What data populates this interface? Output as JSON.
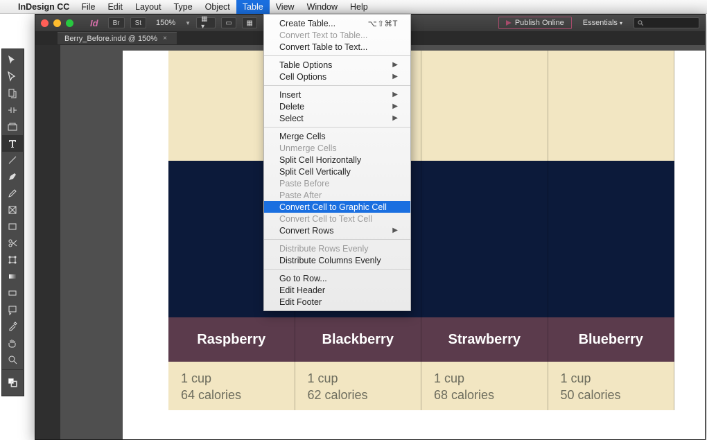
{
  "menubar": {
    "app_name": "InDesign CC",
    "items": [
      "File",
      "Edit",
      "Layout",
      "Type",
      "Object",
      "Table",
      "View",
      "Window",
      "Help"
    ],
    "active": "Table"
  },
  "window": {
    "zoom": "150%",
    "br_btn": "Br",
    "st_btn": "St",
    "publish": "Publish Online",
    "workspace": "Essentials"
  },
  "doc_tab": {
    "title": "Berry_Before.indd @ 150%"
  },
  "table": {
    "headers": [
      "Raspberry",
      "Blackberry",
      "Strawberry",
      "Blueberry"
    ],
    "cells": [
      {
        "amount": "1 cup",
        "calories": "64 calories"
      },
      {
        "amount": "1 cup",
        "calories": "62 calories"
      },
      {
        "amount": "1 cup",
        "calories": "68 calories"
      },
      {
        "amount": "1 cup",
        "calories": "50 calories"
      }
    ]
  },
  "dropdown": {
    "create_table": "Create Table...",
    "create_table_sc": "⌥⇧⌘T",
    "convert_text": "Convert Text to Table...",
    "convert_table_text": "Convert Table to Text...",
    "table_options": "Table Options",
    "cell_options": "Cell Options",
    "insert": "Insert",
    "delete": "Delete",
    "select": "Select",
    "merge": "Merge Cells",
    "unmerge": "Unmerge Cells",
    "split_h": "Split Cell Horizontally",
    "split_v": "Split Cell Vertically",
    "paste_before": "Paste Before",
    "paste_after": "Paste After",
    "to_graphic": "Convert Cell to Graphic Cell",
    "to_text": "Convert Cell to Text Cell",
    "convert_rows": "Convert Rows",
    "dist_rows": "Distribute Rows Evenly",
    "dist_cols": "Distribute Columns Evenly",
    "go_to_row": "Go to Row...",
    "edit_header": "Edit Header",
    "edit_footer": "Edit Footer"
  }
}
